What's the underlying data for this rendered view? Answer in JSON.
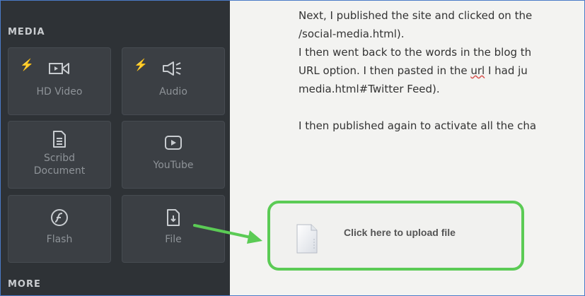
{
  "sidebar": {
    "media_title": "MEDIA",
    "more_title": "MORE",
    "tiles": {
      "hd_video": "HD Video",
      "audio": "Audio",
      "scribd_line1": "Scribd",
      "scribd_line2": "Document",
      "youtube": "YouTube",
      "flash": "Flash",
      "file": "File"
    },
    "icons": {
      "hd_video": "video-camera-icon",
      "audio": "speaker-icon",
      "scribd": "document-icon",
      "youtube": "play-button-icon",
      "flash": "flash-icon",
      "file": "file-download-icon",
      "premium": "lightning-bolt-icon"
    }
  },
  "content": {
    "lines": [
      "Next, I published the site and clicked on the",
      "/social-media.html).",
      "I then went back to the words in the blog th",
      "URL option. I then pasted in the ",
      "url",
      " I had ju",
      "media.html#Twitter Feed).",
      "I then published again to activate all the cha"
    ],
    "upload_label": "Click here to upload file"
  },
  "colors": {
    "sidebar_bg": "#2e3236",
    "highlight": "#5bcb55",
    "bolt": "#f5a623"
  }
}
